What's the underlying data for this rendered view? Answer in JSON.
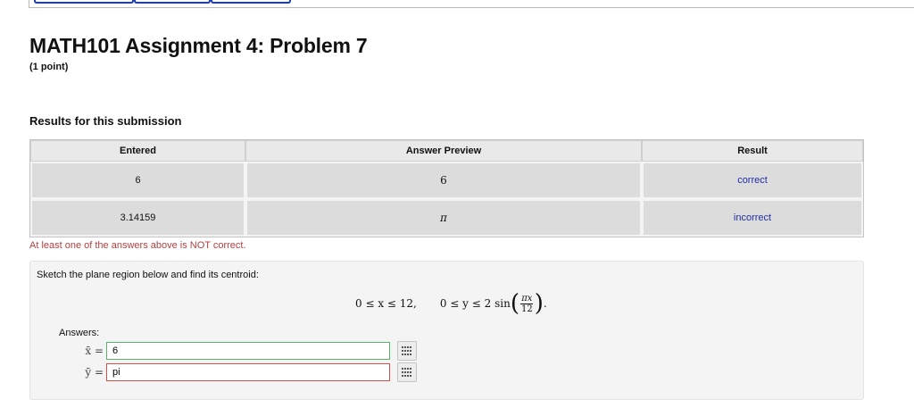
{
  "header": {
    "title": "MATH101 Assignment 4: Problem 7",
    "points": "(1 point)"
  },
  "results": {
    "heading": "Results for this submission",
    "columns": [
      "Entered",
      "Answer Preview",
      "Result"
    ],
    "rows": [
      {
        "entered": "6",
        "preview": "6",
        "result": "correct"
      },
      {
        "entered": "3.14159",
        "preview": "π",
        "result": "incorrect"
      }
    ],
    "warning": "At least one of the answers above is NOT correct."
  },
  "problem": {
    "prompt": "Sketch the plane region below and find its centroid:",
    "formula_x_bounds": "0 ≤ x ≤ 12,",
    "formula_y_prefix": "0 ≤ y ≤ 2 sin",
    "formula_frac_num": "πx",
    "formula_frac_den": "12",
    "formula_suffix": ".",
    "answers_label": "Answers:",
    "answers": [
      {
        "variable": "x̄ =",
        "value": "6",
        "status": "correct"
      },
      {
        "variable": "ȳ =",
        "value": "pi",
        "status": "incorrect"
      }
    ]
  },
  "colors": {
    "correct_bg": "#9cf28f",
    "incorrect_bg": "#cf9292",
    "result_text": "#1e2fa6",
    "warning_text": "#b34040",
    "nav_button_border": "#1f3ea8"
  },
  "icons": {
    "grid_button": "grid-icon"
  }
}
